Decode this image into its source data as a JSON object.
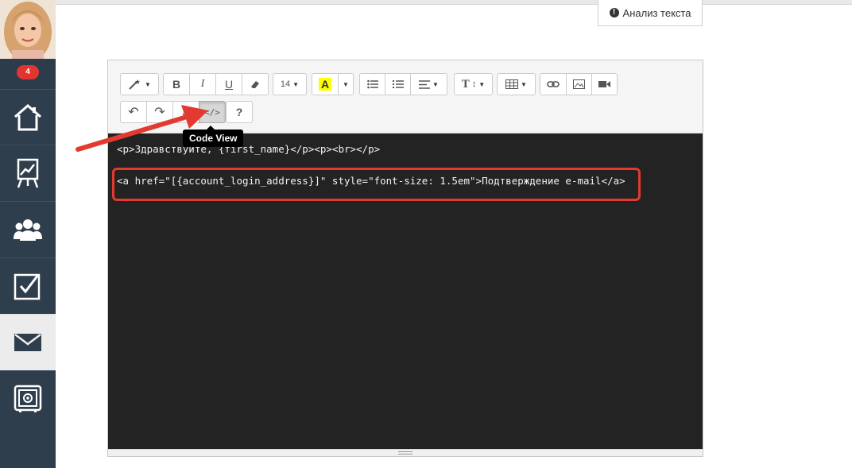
{
  "header": {
    "analysis_button_label": "Анализ текста",
    "analysis_icon": "info-icon"
  },
  "sidebar": {
    "notification_count": "4",
    "items": [
      {
        "name": "home",
        "icon": "house-icon",
        "active": false
      },
      {
        "name": "reports",
        "icon": "chart-board-icon",
        "active": false
      },
      {
        "name": "contacts",
        "icon": "people-icon",
        "active": false
      },
      {
        "name": "tasks",
        "icon": "checkbox-icon",
        "active": false
      },
      {
        "name": "mail",
        "icon": "envelope-icon",
        "active": true
      },
      {
        "name": "settings",
        "icon": "safe-gear-icon",
        "active": false
      }
    ]
  },
  "toolbar": {
    "font_size": "14",
    "tooltip_code_view": "Code View",
    "help_label": "?",
    "bold_label": "B",
    "italic_label": "I",
    "underline_label": "U",
    "font_color_label": "A",
    "text_size_label": "T"
  },
  "editor": {
    "code_line_1": "<p>Здравствуйте, {first_name}</p><p><br></p>",
    "code_line_2": "<a href=\"[{account_login_address}]\" style=\"font-size: 1.5em\">Подтверждение e-mail</a>"
  },
  "colors": {
    "sidebar_bg": "#2f3e4d",
    "code_bg": "#232323",
    "highlight_red": "#e23a30",
    "badge_red": "#e3352f"
  }
}
